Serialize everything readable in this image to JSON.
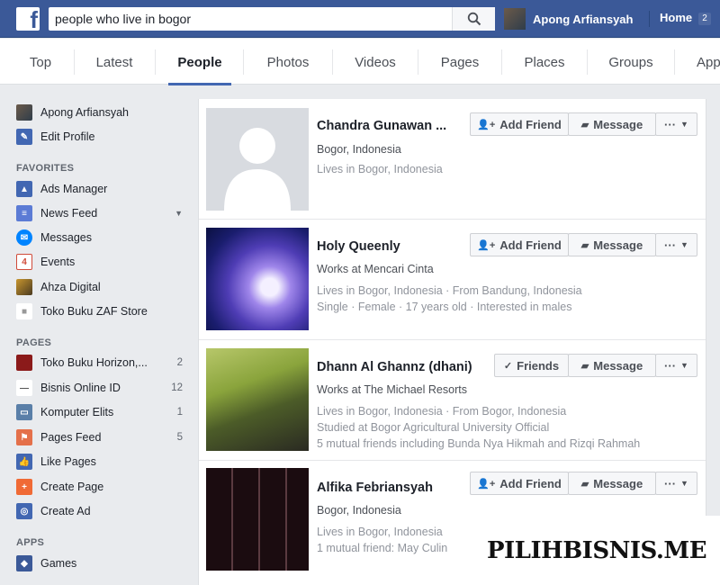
{
  "topbar": {
    "search_value": "people who live in bogor",
    "user_name": "Apong Arfiansyah",
    "home_label": "Home",
    "home_count": "2",
    "brand_color": "#3b5998"
  },
  "tabs": [
    "Top",
    "Latest",
    "People",
    "Photos",
    "Videos",
    "Pages",
    "Places",
    "Groups",
    "Apps"
  ],
  "active_tab": "People",
  "sidebar": {
    "profile_name": "Apong Arfiansyah",
    "edit_profile": "Edit Profile",
    "favorites_heading": "FAVORITES",
    "favorites": [
      {
        "label": "Ads Manager",
        "icon": "ads-manager-icon"
      },
      {
        "label": "News Feed",
        "icon": "news-feed-icon"
      },
      {
        "label": "Messages",
        "icon": "messages-icon"
      },
      {
        "label": "Events",
        "icon": "events-icon"
      },
      {
        "label": "Ahza Digital",
        "icon": "page-thumbnail-icon"
      },
      {
        "label": "Toko Buku ZAF Store",
        "icon": "store-icon"
      }
    ],
    "pages_heading": "PAGES",
    "pages": [
      {
        "label": "Toko Buku Horizon,...",
        "count": "2"
      },
      {
        "label": "Bisnis Online ID",
        "count": "12"
      },
      {
        "label": "Komputer Elits",
        "count": "1"
      },
      {
        "label": "Pages Feed",
        "count": "5"
      },
      {
        "label": "Like Pages",
        "count": ""
      },
      {
        "label": "Create Page",
        "count": ""
      },
      {
        "label": "Create Ad",
        "count": ""
      }
    ],
    "apps_heading": "APPS",
    "apps": [
      {
        "label": "Games"
      }
    ]
  },
  "buttons": {
    "add_friend": "Add Friend",
    "friends": "Friends",
    "message": "Message",
    "more": "···"
  },
  "results": [
    {
      "name": "Chandra Gunawan ...",
      "lines": [
        "Bogor, Indonesia",
        "Lives in Bogor, Indonesia"
      ],
      "relation": "add_friend"
    },
    {
      "name": "Holy Queenly",
      "lines": [
        "Works at Mencari Cinta",
        "Lives in Bogor, Indonesia · From Bandung, Indonesia",
        "Single · Female · 17 years old · Interested in males"
      ],
      "relation": "add_friend"
    },
    {
      "name": "Dhann Al Ghannz (dhani)",
      "lines": [
        "Works at The Michael Resorts",
        "Lives in Bogor, Indonesia · From Bogor, Indonesia",
        "Studied at Bogor Agricultural University Official",
        "5 mutual friends including Bunda Nya Hikmah and Rizqi Rahmah"
      ],
      "relation": "friends"
    },
    {
      "name": "Alfika Febriansyah",
      "lines": [
        "Bogor, Indonesia",
        "Lives in Bogor, Indonesia",
        "1 mutual friend: May Culin"
      ],
      "relation": "add_friend"
    }
  ],
  "watermark": "PILIHBISNIS.ME"
}
